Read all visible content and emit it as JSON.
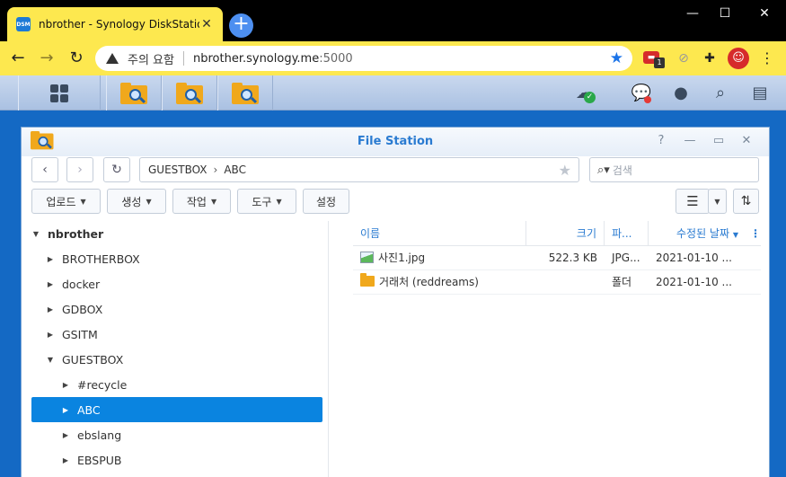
{
  "browser": {
    "tab_title": "nbrother - Synology DiskStation",
    "favicon_text": "DSM",
    "security_label": "주의 요함",
    "url_host": "nbrother.synology.me",
    "url_port": ":5000",
    "extension_badge": "1"
  },
  "window": {
    "title": "File Station"
  },
  "path": {
    "crumbs": [
      "GUESTBOX",
      "ABC"
    ]
  },
  "search": {
    "placeholder": "검색"
  },
  "actions": {
    "upload": "업로드",
    "create": "생성",
    "action": "작업",
    "tools": "도구",
    "settings": "설정"
  },
  "tree": {
    "root": "nbrother",
    "items": [
      "BROTHERBOX",
      "docker",
      "GDBOX",
      "GSITM",
      "GUESTBOX",
      "#recycle",
      "ABC",
      "ebslang",
      "EBSPUB"
    ]
  },
  "list": {
    "columns": {
      "name": "이름",
      "size": "크기",
      "type": "파...",
      "modified": "수정된 날짜"
    },
    "rows": [
      {
        "name": "사진1.jpg",
        "size": "522.3 KB",
        "type": "JPG...",
        "modified": "2021-01-10 ..."
      },
      {
        "name": "거래처 (reddreams)",
        "size": "",
        "type": "폴더",
        "modified": "2021-01-10 ..."
      }
    ]
  },
  "colors": {
    "accent": "#0a84e0",
    "chrome_tab": "#fde84f",
    "desktop": "#1469c4"
  }
}
